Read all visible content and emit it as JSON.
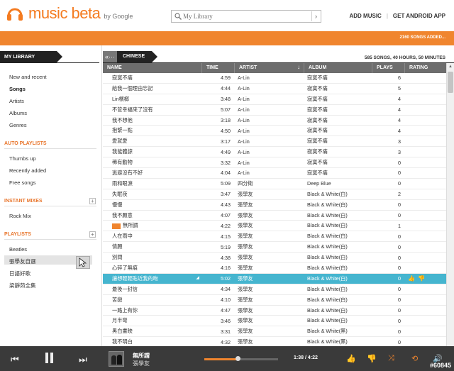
{
  "app": {
    "logo_text": "music beta",
    "logo_by": "by Google"
  },
  "search": {
    "placeholder": "My Library"
  },
  "top_links": {
    "add_music": "ADD MUSIC",
    "separator": "|",
    "get_app": "GET ANDROID APP"
  },
  "status": {
    "songs_added": "2160 SONGS ADDED..."
  },
  "sidebar": {
    "library_tab": "MY LIBRARY",
    "library_items": [
      "New and recent",
      "Songs",
      "Artists",
      "Albums",
      "Genres"
    ],
    "auto_playlists_title": "AUTO PLAYLISTS",
    "auto_playlists": [
      "Thumbs up",
      "Recently added",
      "Free songs"
    ],
    "instant_mixes_title": "INSTANT MIXES",
    "instant_mixes": [
      "Rock Mix"
    ],
    "playlists_title": "PLAYLISTS",
    "playlists": [
      "Beatles",
      "張學友自選",
      "日語好歌",
      "梁靜茹全集"
    ],
    "plus": "+"
  },
  "main": {
    "back_label": "«···",
    "title": "CHINESE",
    "summary": "585 SONGS, 40 HOURS, 50 MINUTES",
    "columns": [
      "NAME",
      "TIME",
      "ARTIST",
      "ALBUM",
      "PLAYS",
      "RATING"
    ],
    "sort_arrow": "↓",
    "rows": [
      {
        "name": "寂寞不痛",
        "time": "4:59",
        "artist": "A-Lin",
        "album": "寂寞不痛",
        "plays": "6"
      },
      {
        "name": "給我一個理由忘記",
        "time": "4:44",
        "artist": "A-Lin",
        "album": "寂寞不痛",
        "plays": "5"
      },
      {
        "name": "Lin檳榔",
        "time": "3:48",
        "artist": "A-Lin",
        "album": "寂寞不痛",
        "plays": "4"
      },
      {
        "name": "不管幸福來了沒有",
        "time": "5:07",
        "artist": "A-Lin",
        "album": "寂寞不痛",
        "plays": "4"
      },
      {
        "name": "我不想他",
        "time": "3:18",
        "artist": "A-Lin",
        "album": "寂寞不痛",
        "plays": "4"
      },
      {
        "name": "抱緊一點",
        "time": "4:50",
        "artist": "A-Lin",
        "album": "寂寞不痛",
        "plays": "4"
      },
      {
        "name": "愛就愛",
        "time": "3:17",
        "artist": "A-Lin",
        "album": "寂寞不痛",
        "plays": "3"
      },
      {
        "name": "我能體諒",
        "time": "4:49",
        "artist": "A-Lin",
        "album": "寂寞不痛",
        "plays": "3"
      },
      {
        "name": "稀有動物",
        "time": "3:32",
        "artist": "A-Lin",
        "album": "寂寞不痛",
        "plays": "0"
      },
      {
        "name": "逃避沒有不好",
        "time": "4:04",
        "artist": "A-Lin",
        "album": "寂寞不痛",
        "plays": "0"
      },
      {
        "name": "雨和眼淚",
        "time": "5:09",
        "artist": "四分衛",
        "album": "Deep Blue",
        "plays": "0"
      },
      {
        "name": "失眠夜",
        "time": "3:47",
        "artist": "張學友",
        "album": "Black & White(白)",
        "plays": "2"
      },
      {
        "name": "慢慢",
        "time": "4:43",
        "artist": "張學友",
        "album": "Black & White(白)",
        "plays": "0"
      },
      {
        "name": "我不願意",
        "time": "4:07",
        "artist": "張學友",
        "album": "Black & White(白)",
        "plays": "0"
      },
      {
        "name": "無所謂",
        "time": "4:22",
        "artist": "張學友",
        "album": "Black & White(白)",
        "plays": "1",
        "playing": true
      },
      {
        "name": "人在雨中",
        "time": "4:15",
        "artist": "張學友",
        "album": "Black & White(白)",
        "plays": "0"
      },
      {
        "name": "情願",
        "time": "5:19",
        "artist": "張學友",
        "album": "Black & White(白)",
        "plays": "0"
      },
      {
        "name": "別問",
        "time": "4:38",
        "artist": "張學友",
        "album": "Black & White(白)",
        "plays": "0"
      },
      {
        "name": "心碎了無痕",
        "time": "4:16",
        "artist": "張學友",
        "album": "Black & White(白)",
        "plays": "0"
      },
      {
        "name": "讓想輕輕貼近我的吻",
        "time": "5:02",
        "artist": "張學友",
        "album": "Black & White(白)",
        "plays": "0",
        "selected": true
      },
      {
        "name": "最後一封信",
        "time": "4:34",
        "artist": "張學友",
        "album": "Black & White(白)",
        "plays": "0"
      },
      {
        "name": "苦戀",
        "time": "4:10",
        "artist": "張學友",
        "album": "Black & White(白)",
        "plays": "0"
      },
      {
        "name": "一路上有你",
        "time": "4:47",
        "artist": "張學友",
        "album": "Black & White(白)",
        "plays": "0"
      },
      {
        "name": "月半彎",
        "time": "3:46",
        "artist": "張學友",
        "album": "Black & White(白)",
        "plays": "0"
      },
      {
        "name": "黑白畫映",
        "time": "3:31",
        "artist": "張學友",
        "album": "Black & White(黑)",
        "plays": "0"
      },
      {
        "name": "我不明白",
        "time": "4:32",
        "artist": "張學友",
        "album": "Black & White(黑)",
        "plays": "0"
      }
    ]
  },
  "player": {
    "title": "無所謂",
    "artist": "張學友",
    "time": "1:38 / 4:22",
    "progress_fraction": 0.45
  },
  "watermark": "#60845"
}
